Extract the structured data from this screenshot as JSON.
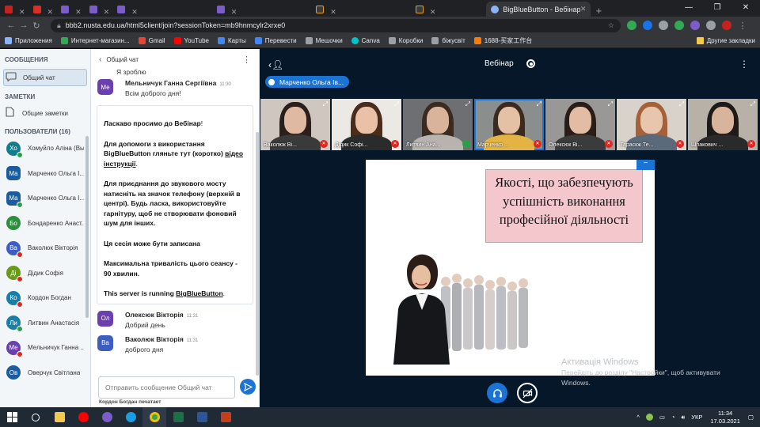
{
  "browser": {
    "active_tab_title": "BigBlueButton - Вебінар",
    "url": "bbb2.nusta.edu.ua/html5client/join?sessionToken=mb9hnmcylr2xrxe0",
    "bookmarks": [
      {
        "label": "Приложения",
        "color": "#5f6368"
      },
      {
        "label": "Интернет-магазин...",
        "color": "#34a853"
      },
      {
        "label": "Gmail",
        "color": "#ea4335"
      },
      {
        "label": "YouTube",
        "color": "#ff0000"
      },
      {
        "label": "Карты",
        "color": "#4285f4"
      },
      {
        "label": "Перевести",
        "color": "#4285f4"
      },
      {
        "label": "Мешочки",
        "color": "#5f6368"
      },
      {
        "label": "Canva",
        "color": "#00c4cc"
      },
      {
        "label": "Коробки",
        "color": "#5f6368"
      },
      {
        "label": "біжусвіт",
        "color": "#5f6368"
      },
      {
        "label": "1688-买家工作台",
        "color": "#ff7a00"
      }
    ],
    "bookmarks_other": "Другие закладки"
  },
  "left": {
    "messages_header": "СООБЩЕНИЯ",
    "public_chat": "Общий чат",
    "notes_header": "ЗАМЕТКИ",
    "shared_notes": "Общие заметки",
    "users_header": "ПОЛЬЗОВАТЕЛИ (16)",
    "users": [
      {
        "initials": "Хо",
        "name": "Хомуйло Аліна (Вы)",
        "color": "#0f7d8d",
        "round": true,
        "mic": "#2c9e4a"
      },
      {
        "initials": "Ма",
        "name": "Марченко Ольга І...",
        "color": "#1a5c9e",
        "round": false,
        "mic": ""
      },
      {
        "initials": "Ма",
        "name": "Марченко Ольга І...",
        "color": "#1a5c9e",
        "round": false,
        "mic": "#2c9e4a"
      },
      {
        "initials": "Бо",
        "name": "Бондаренко Анаст...",
        "color": "#2d8f3c",
        "round": true,
        "mic": ""
      },
      {
        "initials": "Ва",
        "name": "Ваколюк Вікторія",
        "color": "#3c5ec1",
        "round": true,
        "mic": "#df2721"
      },
      {
        "initials": "Ді",
        "name": "Дідик Софія",
        "color": "#6a9a1c",
        "round": true,
        "mic": "#df2721"
      },
      {
        "initials": "Ко",
        "name": "Кордон Богдан",
        "color": "#1a7fa6",
        "round": true,
        "mic": "#df2721"
      },
      {
        "initials": "Ли",
        "name": "Литвин Анастасія",
        "color": "#1a7fa6",
        "round": true,
        "mic": "#2c9e4a"
      },
      {
        "initials": "Ме",
        "name": "Мельничук Ганна ...",
        "color": "#6b3fb0",
        "round": true,
        "mic": "#df2721"
      },
      {
        "initials": "Ов",
        "name": "Оверчук Світлана",
        "color": "#1a5c9e",
        "round": true,
        "mic": ""
      }
    ]
  },
  "chat": {
    "title": "Общий чат",
    "prev_tail": "Я зроблю",
    "messages_top": [
      {
        "initials": "Ме",
        "author": "Мельничук Ганна Сергіївна",
        "time": "11:30",
        "text": "Всім доброго дня!",
        "color": "#6b3fb0"
      }
    ],
    "welcome": {
      "p1_pre": "Ласкаво просимо до ",
      "p1_bold": "Вебінар",
      "p1_post": "!",
      "p2_pre": "Для допомоги з використання BigBlueButton гляньте тут (коротко) ",
      "p2_link": "відео інструкції",
      "p2_post": ".",
      "p3_pre": "Для приєднання до звукового мосту натисніть на значок телефону (верхній в центрі). ",
      "p3_bold": "Будь ласка, використовуйте гарнітуру, щоб не створювати фоновий шум для інших.",
      "p4": "Ця сесія може бути записана",
      "p5": "Максимальна тривалість цього сеансу - 90 хвилин.",
      "p6_pre": "This server is running ",
      "p6_link": "BigBlueButton",
      "p6_post": "."
    },
    "messages_bottom": [
      {
        "initials": "Ол",
        "author": "Олексюк Вікторія",
        "time": "11:31",
        "text": "Добрий день",
        "color": "#6b3fb0"
      },
      {
        "initials": "Ва",
        "author": "Ваколюк Вікторія",
        "time": "11:31",
        "text": "доброго дня",
        "color": "#3c5ec1"
      }
    ],
    "input_placeholder": "Отправить сообщение Общий чат",
    "typing": "Кордон Богдан печатает"
  },
  "main": {
    "title": "Вебінар",
    "talker": "Марченко Ольга Ів...",
    "videos": [
      {
        "name": "Ваколюк Ві...",
        "bg": "#cfc6bf",
        "hair": "#2b1f1a",
        "skin": "#e0b9a2",
        "body": "#3a3a3a",
        "mute": true,
        "active": false
      },
      {
        "name": "Дідик Софі...",
        "bg": "#ece8e4",
        "hair": "#4a2c1c",
        "skin": "#eac1a6",
        "body": "#2b2b2b",
        "mute": true,
        "active": false
      },
      {
        "name": "Литвин Ана...",
        "bg": "#6d6f72",
        "hair": "#3b2a20",
        "skin": "#d9b49a",
        "body": "#b7b3ae",
        "mute": false,
        "active": false
      },
      {
        "name": "Марченко ...",
        "bg": "#8a8f8e",
        "hair": "#3a2a1f",
        "skin": "#e4c0a4",
        "body": "#e3b443",
        "mute": true,
        "active": true
      },
      {
        "name": "Олексюк Ві...",
        "bg": "#9a9896",
        "hair": "#2a1d18",
        "skin": "#e2bca3",
        "body": "#3b3b3b",
        "mute": true,
        "active": false
      },
      {
        "name": "Тараскж Те...",
        "bg": "#d8d2cb",
        "hair": "#a5623a",
        "skin": "#e8c6ad",
        "body": "#5a6a7a",
        "mute": true,
        "active": false
      },
      {
        "name": "Шпакович ...",
        "bg": "#b8b1a8",
        "hair": "#1e1a18",
        "skin": "#d7b49b",
        "body": "#2a2a2a",
        "mute": true,
        "active": false
      }
    ],
    "slide_title": "Якості, що забезпечують успішність виконання професійної діяльності",
    "watermark_title": "Активація Windows",
    "watermark_sub": "Перейдіть до розділу \"Настройки\", щоб активувати Windows."
  },
  "taskbar": {
    "lang": "УКР",
    "time": "11:34",
    "date": "17.03.2021"
  }
}
